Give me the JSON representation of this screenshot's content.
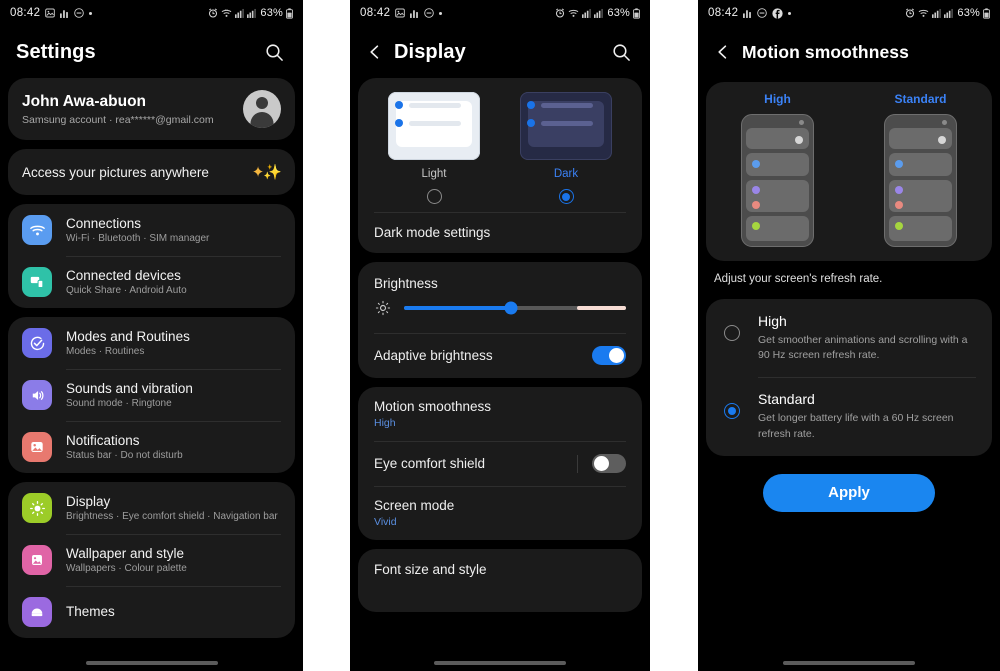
{
  "statusbar": {
    "time": "08:42",
    "battery": "63%",
    "left_icons": [
      "gallery-icon",
      "signal-bars-icon",
      "dnd-icon",
      "dot-icon"
    ],
    "left_icons_p3": [
      "signal-bars-icon",
      "dnd-icon",
      "facebook-icon",
      "dot-icon"
    ],
    "right_icons": [
      "alarm-icon",
      "wifi-calling-icon",
      "sim1-signal-icon",
      "sim2-signal-icon",
      "battery-icon"
    ]
  },
  "panel1": {
    "header": {
      "title": "Settings",
      "search_icon": "search-icon"
    },
    "account": {
      "name": "John Awa-abuon",
      "subtitle": "Samsung account  ·  rea******@gmail.com",
      "avatar": "person-avatar"
    },
    "promo": {
      "label": "Access your pictures anywhere",
      "icon": "sparkles-icon"
    },
    "groups": [
      {
        "items": [
          {
            "title": "Connections",
            "subtitle": "Wi-Fi  ·  Bluetooth  ·  SIM manager",
            "icon": "wifi-icon",
            "color": "#5a9cf0"
          },
          {
            "title": "Connected devices",
            "subtitle": "Quick Share  ·  Android Auto",
            "icon": "devices-icon",
            "color": "#2fc2a8"
          }
        ]
      },
      {
        "items": [
          {
            "title": "Modes and Routines",
            "subtitle": "Modes  ·  Routines",
            "icon": "check-circle-icon",
            "color": "#6b6ce8"
          },
          {
            "title": "Sounds and vibration",
            "subtitle": "Sound mode  ·  Ringtone",
            "icon": "speaker-icon",
            "color": "#8b7ce8"
          },
          {
            "title": "Notifications",
            "subtitle": "Status bar  ·  Do not disturb",
            "icon": "bell-image-icon",
            "color": "#e8796f"
          }
        ]
      },
      {
        "items": [
          {
            "title": "Display",
            "subtitle": "Brightness  ·  Eye comfort shield  ·  Navigation bar",
            "icon": "brightness-icon",
            "color": "#9ccc28"
          },
          {
            "title": "Wallpaper and style",
            "subtitle": "Wallpapers  ·  Colour palette",
            "icon": "picture-icon",
            "color": "#e064a6"
          },
          {
            "title": "Themes",
            "subtitle": "",
            "icon": "themes-icon",
            "color": "#9b6ae0"
          }
        ]
      }
    ]
  },
  "panel2": {
    "header": {
      "title": "Display",
      "back_icon": "back-chevron-icon",
      "search_icon": "search-icon"
    },
    "themes": [
      {
        "label": "Light",
        "selected": false
      },
      {
        "label": "Dark",
        "selected": true
      }
    ],
    "dark_mode_settings": "Dark mode settings",
    "brightness": {
      "label": "Brightness",
      "icon": "sun-icon",
      "value_percent": 48
    },
    "adaptive_brightness": {
      "label": "Adaptive brightness",
      "state": "on"
    },
    "motion_smoothness": {
      "label": "Motion smoothness",
      "value": "High"
    },
    "eye_comfort_shield": {
      "label": "Eye comfort shield",
      "state": "off"
    },
    "screen_mode": {
      "label": "Screen mode",
      "value": "Vivid"
    },
    "font_size_and_style": "Font size and style"
  },
  "panel3": {
    "header": {
      "title": "Motion smoothness",
      "back_icon": "back-chevron-icon"
    },
    "previews": [
      {
        "label": "High"
      },
      {
        "label": "Standard"
      }
    ],
    "hint": "Adjust your screen's refresh rate.",
    "options": [
      {
        "title": "High",
        "description": "Get smoother animations and scrolling with a 90 Hz screen refresh rate.",
        "selected": false
      },
      {
        "title": "Standard",
        "description": "Get longer battery life with a 60 Hz screen refresh rate.",
        "selected": true
      }
    ],
    "apply_button": "Apply"
  },
  "colors": {
    "accent_blue": "#1a7bf0",
    "link_blue": "#5a8ee0",
    "card_bg": "#1b1b1b",
    "page_bg": "#000000"
  }
}
